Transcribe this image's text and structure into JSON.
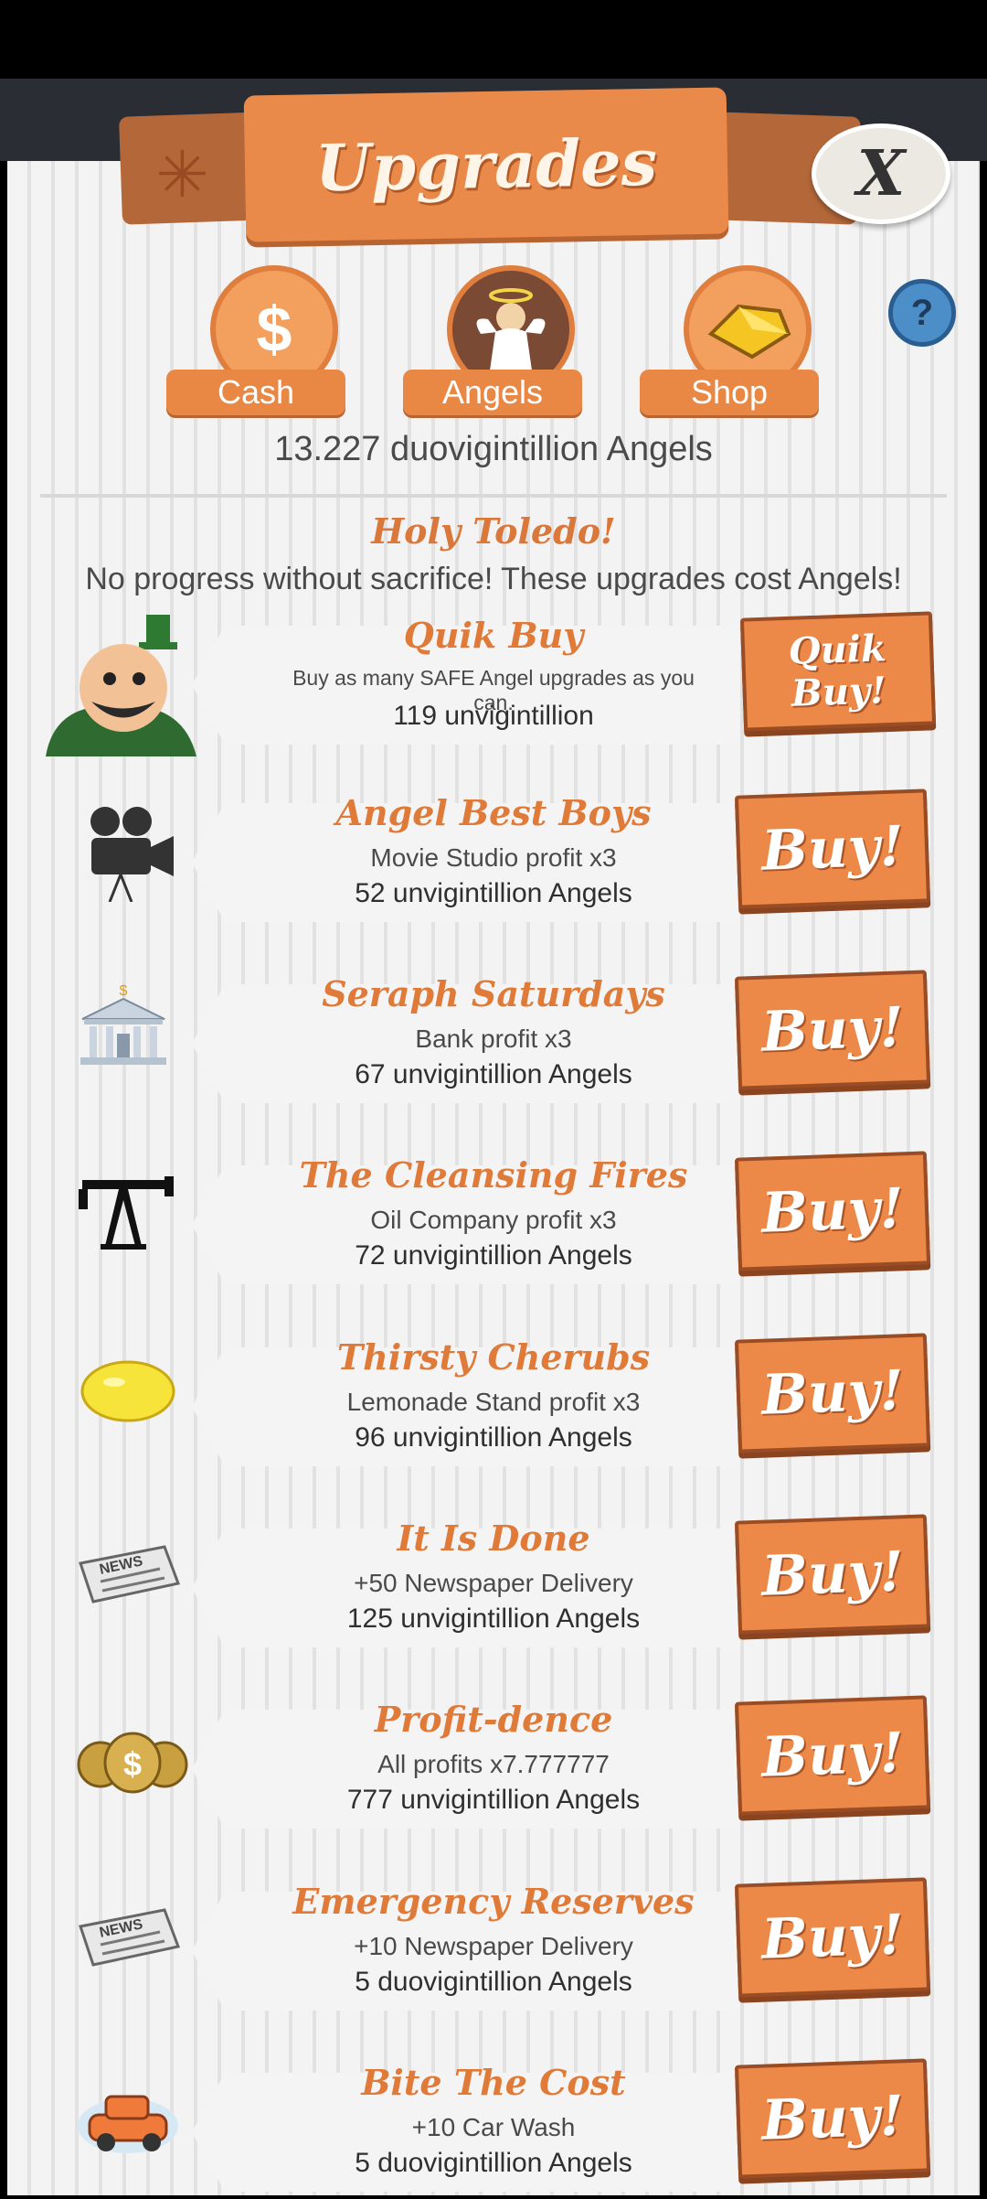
{
  "window": {
    "title": "Upgrades",
    "close_label": "X",
    "help_label": "?"
  },
  "nav": [
    {
      "id": "cash",
      "label": "Cash",
      "icon": "dollar-icon"
    },
    {
      "id": "angels",
      "label": "Angels",
      "icon": "angel-icon"
    },
    {
      "id": "shop",
      "label": "Shop",
      "icon": "gold-icon"
    }
  ],
  "angels_count": "13.227 duovigintillion Angels",
  "header": {
    "title": "Holy Toledo!",
    "subtitle": "No progress without sacrifice! These upgrades cost Angels!"
  },
  "quik_buy": {
    "title": "Quik Buy",
    "desc": "Buy as many SAFE Angel upgrades as you can.",
    "cost": "119 unvigintillion",
    "button": "Quik\nBuy!"
  },
  "buy_label": "Buy!",
  "upgrades": [
    {
      "title": "Angel Best Boys",
      "desc": "Movie Studio profit x3",
      "cost": "52 unvigintillion Angels",
      "icon": "movie-camera-icon"
    },
    {
      "title": "Seraph Saturdays",
      "desc": "Bank profit x3",
      "cost": "67 unvigintillion Angels",
      "icon": "bank-icon"
    },
    {
      "title": "The Cleansing Fires",
      "desc": "Oil Company profit x3",
      "cost": "72 unvigintillion Angels",
      "icon": "oil-pump-icon"
    },
    {
      "title": "Thirsty Cherubs",
      "desc": "Lemonade Stand profit x3",
      "cost": "96 unvigintillion Angels",
      "icon": "lemon-icon"
    },
    {
      "title": "It Is Done",
      "desc": "+50 Newspaper Delivery",
      "cost": "125 unvigintillion Angels",
      "icon": "newspaper-icon"
    },
    {
      "title": "Profit-dence",
      "desc": "All profits x7.777777",
      "cost": "777 unvigintillion Angels",
      "icon": "money-bags-icon"
    },
    {
      "title": "Emergency Reserves",
      "desc": "+10 Newspaper Delivery",
      "cost": "5 duovigintillion Angels",
      "icon": "newspaper-icon"
    },
    {
      "title": "Bite The Cost",
      "desc": "+10 Car Wash",
      "cost": "5 duovigintillion Angels",
      "icon": "car-icon"
    }
  ],
  "icon_texts": {
    "newspaper": "NEWS"
  },
  "colors": {
    "accent": "#ec8848",
    "title": "#df7a38",
    "help": "#4c8fc8"
  }
}
